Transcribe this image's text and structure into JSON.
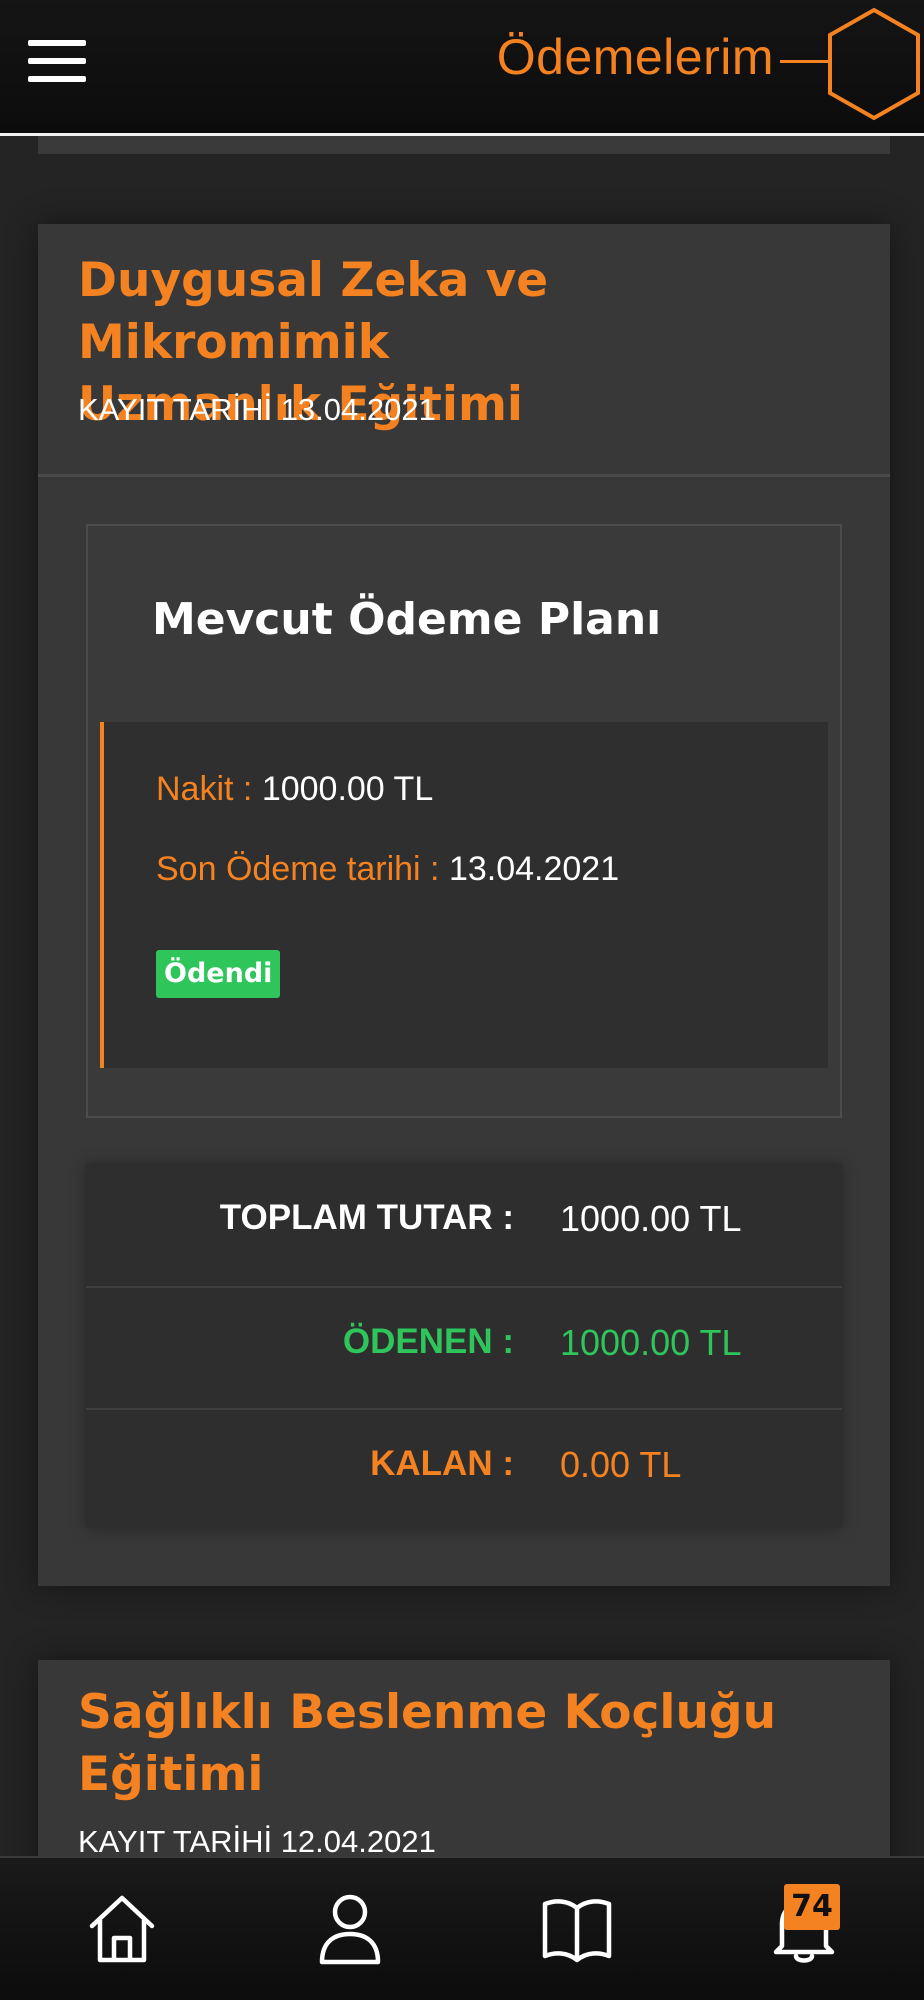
{
  "header": {
    "title": "Ödemelerim",
    "menu_icon": "hamburger-icon",
    "logo_icon": "hexagon-logo-icon",
    "accent_color": "#f58220"
  },
  "courses": [
    {
      "title_line1": "Duygusal Zeka ve Mikromimik",
      "title_line2": "Uzmanlık Eğitimi",
      "registration_date": "KAYIT TARİHİ 13.04.2021",
      "plan": {
        "heading": "Mevcut Ödeme Planı",
        "cash_label": "Nakit :",
        "cash_value": "1000.00 TL",
        "due_label": "Son Ödeme tarihi :",
        "due_value": "13.04.2021",
        "status": "Ödendi",
        "status_color": "#2ec55b"
      },
      "totals": {
        "total_label": "TOPLAM TUTAR :",
        "total_value": "1000.00 TL",
        "paid_label": "ÖDENEN :",
        "paid_value": "1000.00 TL",
        "remaining_label": "KALAN :",
        "remaining_value": "0.00 TL"
      }
    },
    {
      "title_line1": "Sağlıklı Beslenme Koçluğu",
      "title_line2": "Eğitimi",
      "registration_date": "KAYIT TARİHİ 12.04.2021"
    }
  ],
  "bottom_nav": {
    "items": [
      "home-icon",
      "user-icon",
      "book-icon",
      "bell-icon"
    ],
    "notification_count": "74"
  }
}
